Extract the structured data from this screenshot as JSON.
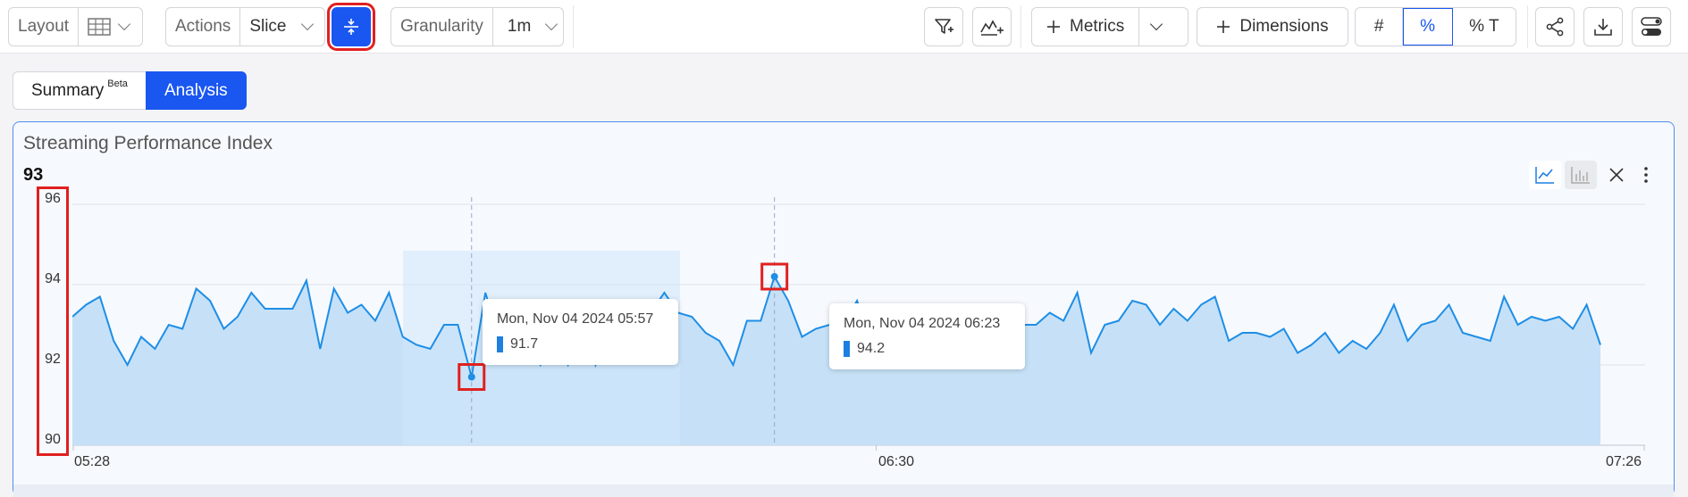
{
  "toolbar": {
    "layout_label": "Layout",
    "actions_label": "Actions",
    "actions_value": "Slice",
    "granularity_label": "Granularity",
    "granularity_value": "1m",
    "metrics_label": "Metrics",
    "dimensions_label": "Dimensions",
    "format_options": [
      "#",
      "%",
      "% T"
    ],
    "format_selected": "%",
    "accent": "#1a56f0"
  },
  "tabs": [
    {
      "label": "Summary",
      "badge": "Beta"
    },
    {
      "label": "Analysis"
    }
  ],
  "card": {
    "title": "Streaming Performance Index",
    "value": "93"
  },
  "tooltips": [
    {
      "date": "Mon, Nov 04 2024 05:57",
      "value": "91.7"
    },
    {
      "date": "Mon, Nov 04 2024 06:23",
      "value": "94.2"
    }
  ],
  "chart_data": {
    "type": "area",
    "title": "Streaming Performance Index",
    "y_ticks": [
      "96",
      "94",
      "92",
      "90"
    ],
    "x_ticks": [
      "05:28",
      "06:30",
      "07:26"
    ],
    "ylim": [
      90,
      96
    ],
    "x_range_minutes": [
      0,
      118
    ],
    "grid": true,
    "line_color": "#1e8ee6",
    "fill_color": "#c3dff7",
    "series": [
      {
        "values": [
          93.2,
          93.5,
          93.7,
          92.6,
          92.0,
          92.7,
          92.4,
          93.0,
          92.9,
          93.9,
          93.6,
          92.9,
          93.2,
          93.8,
          93.4,
          93.4,
          93.4,
          94.1,
          92.4,
          93.9,
          93.3,
          93.5,
          93.1,
          93.8,
          92.7,
          92.5,
          92.4,
          93.0,
          93.0,
          91.7,
          93.8,
          92.7,
          92.7,
          92.7,
          92.0,
          92.7,
          92.0,
          92.9,
          92.0,
          93.2,
          93.3,
          92.8,
          93.3,
          93.8,
          93.3,
          93.2,
          92.8,
          92.6,
          92.0,
          93.1,
          93.1,
          94.2,
          93.6,
          92.7,
          92.9,
          93.0,
          93.0,
          93.6,
          92.6,
          92.6,
          93.1,
          93.2,
          92.9,
          93.5,
          93.1,
          92.8,
          93.2,
          92.7,
          93.4,
          93.0,
          93.0,
          93.3,
          93.1,
          93.8,
          92.3,
          93.0,
          93.1,
          93.6,
          93.5,
          93.0,
          93.4,
          93.1,
          93.5,
          93.7,
          92.6,
          92.8,
          92.8,
          92.7,
          92.9,
          92.3,
          92.5,
          92.8,
          92.3,
          92.6,
          92.4,
          92.8,
          93.5,
          92.6,
          93.0,
          93.1,
          93.5,
          92.8,
          92.7,
          92.6,
          93.7,
          93.0,
          93.2,
          93.1,
          93.2,
          92.9,
          93.5,
          92.5
        ]
      }
    ],
    "highlight_points": [
      {
        "index": 29,
        "value": 91.7
      },
      {
        "index": 51,
        "value": 94.2
      }
    ]
  }
}
